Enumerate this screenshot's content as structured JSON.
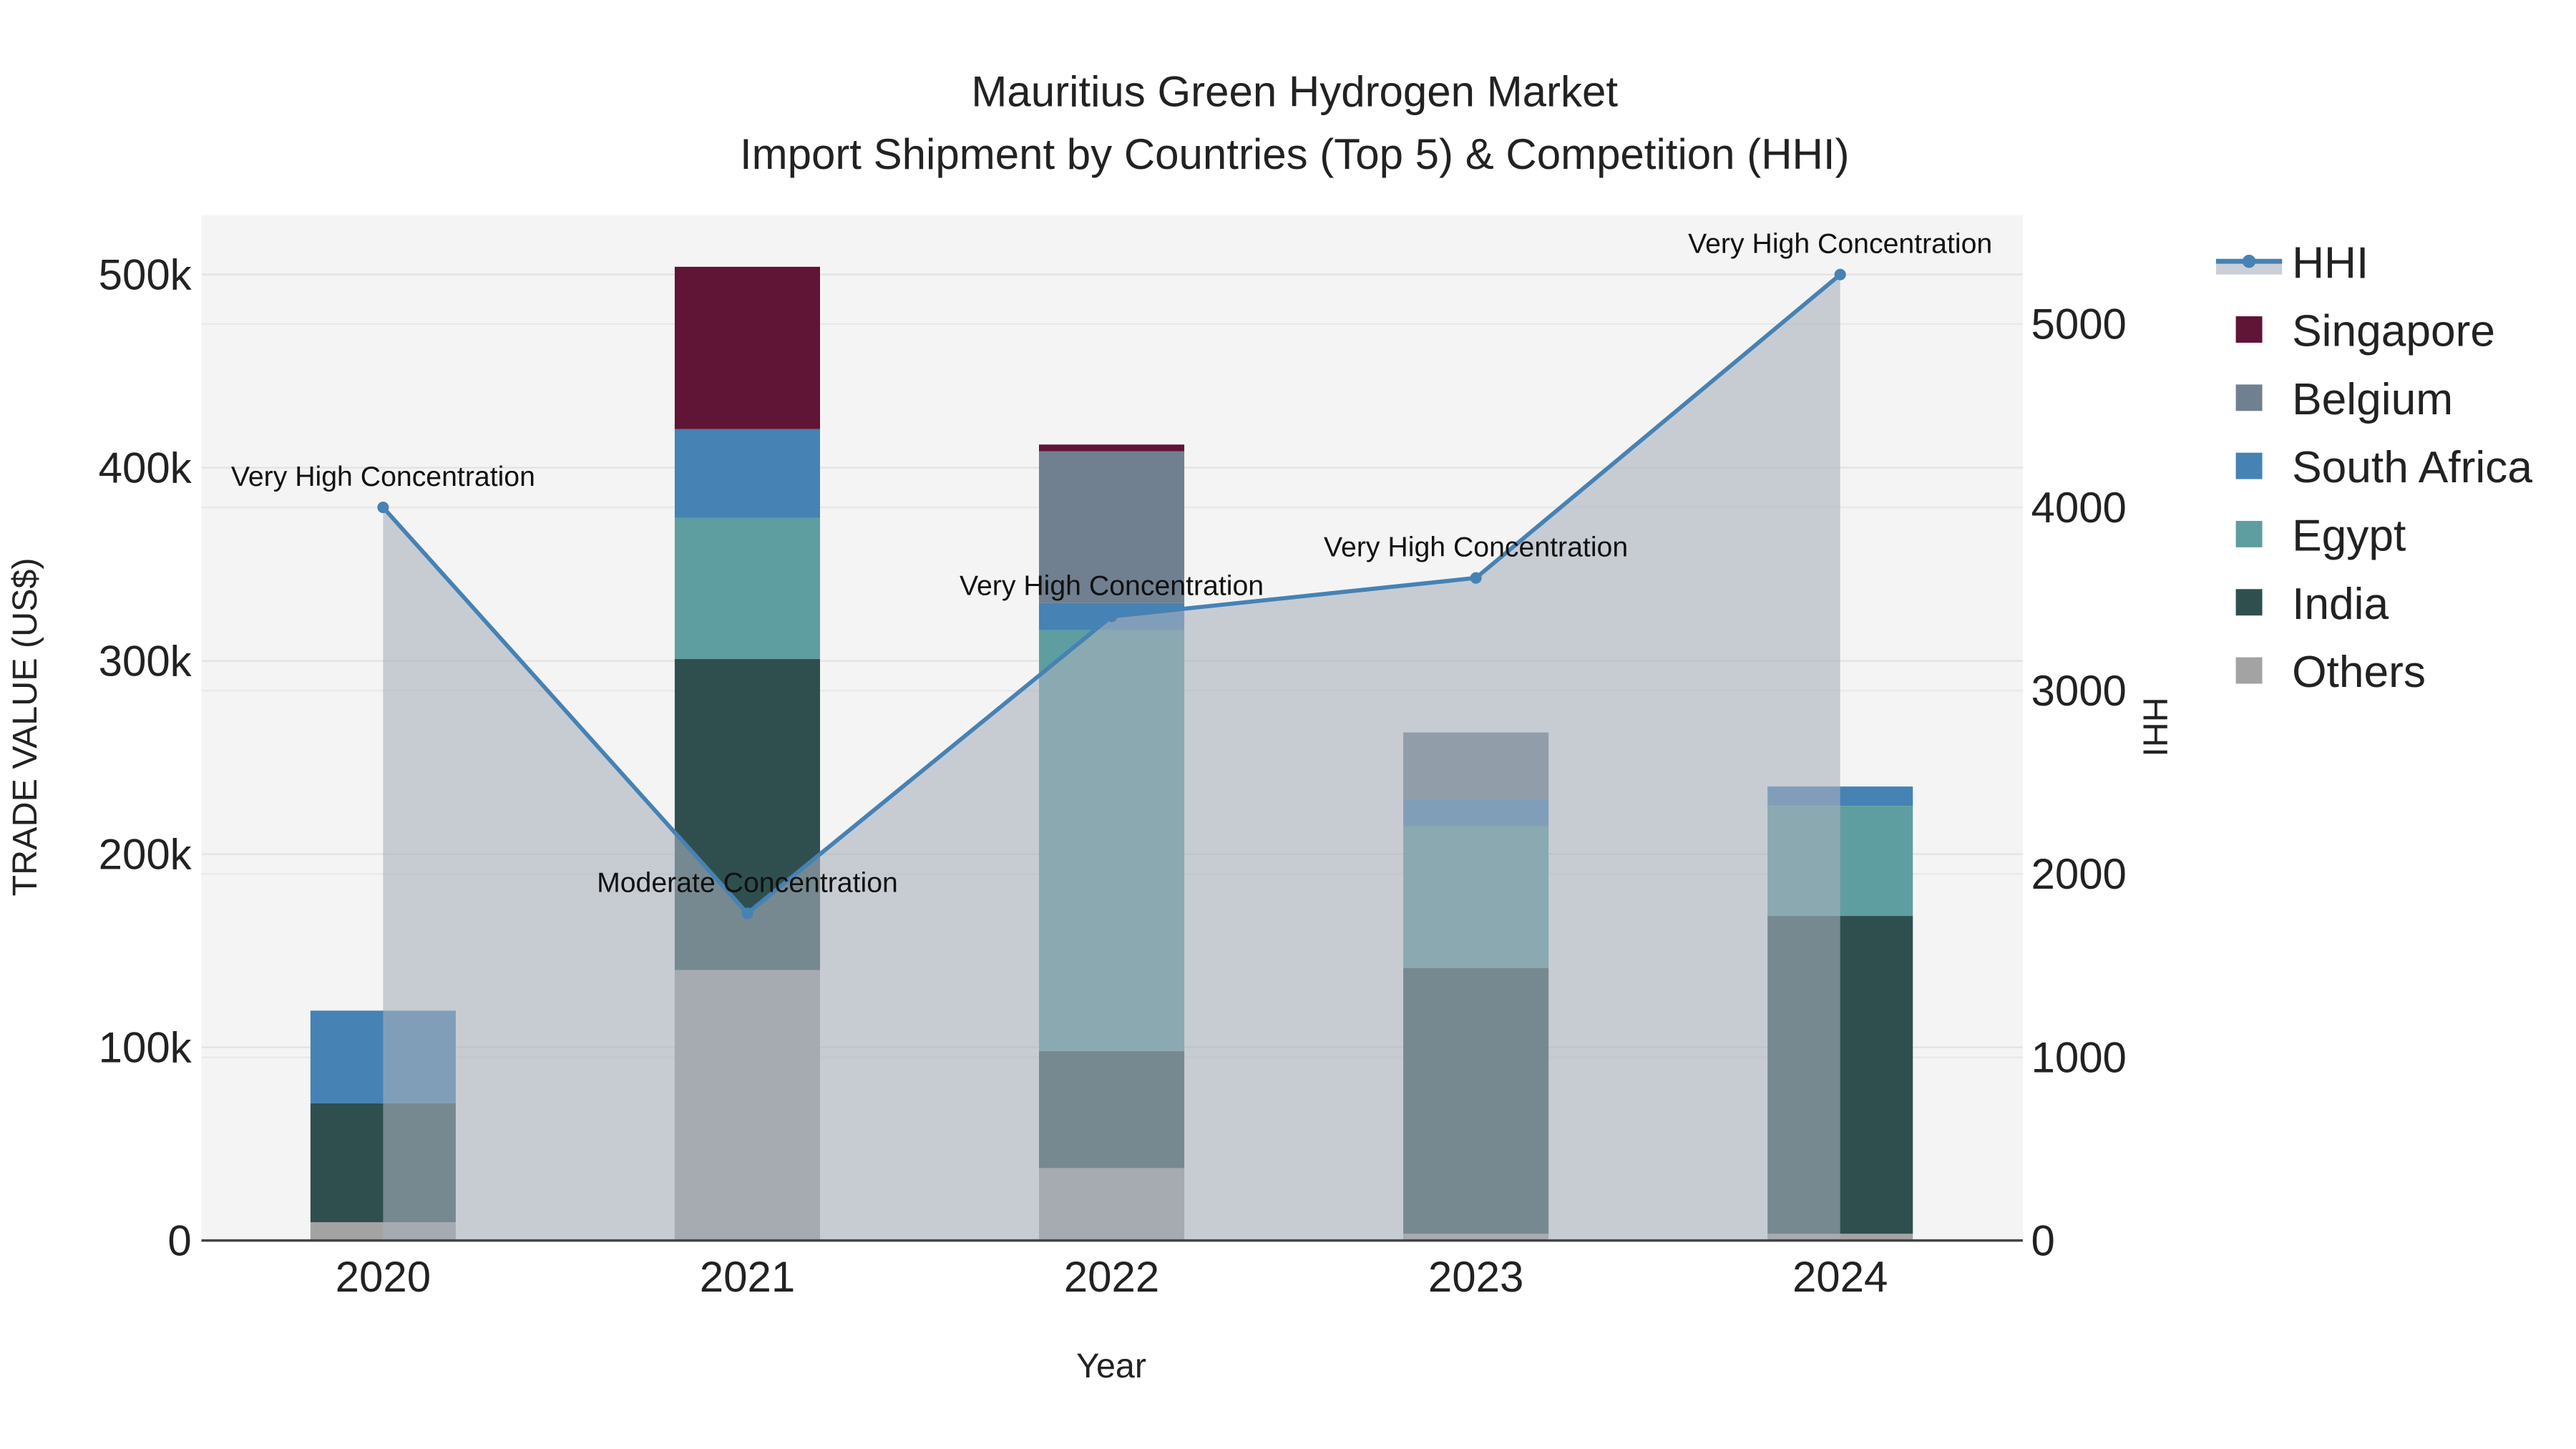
{
  "chart_data": {
    "type": "bar",
    "title": "Mauritius Green Hydrogen Market",
    "subtitle": "Import Shipment by Countries (Top 5) & Competition (HHI)",
    "xlabel": "Year",
    "ylabel": "TRADE VALUE (US$)",
    "y2label": "HHI",
    "categories": [
      "2020",
      "2021",
      "2022",
      "2023",
      "2024"
    ],
    "ylim": [
      0,
      530000
    ],
    "y2lim": [
      0,
      5600
    ],
    "yticks": [
      0,
      100000,
      200000,
      300000,
      400000,
      500000
    ],
    "ytick_labels": [
      "0",
      "100k",
      "200k",
      "300k",
      "400k",
      "500k"
    ],
    "y2ticks": [
      0,
      1000,
      2000,
      3000,
      4000,
      5000
    ],
    "y2tick_labels": [
      "0",
      "1000",
      "2000",
      "3000",
      "4000",
      "5000"
    ],
    "stacked": true,
    "legend_position": "right",
    "series": [
      {
        "name": "Others",
        "color": "#a3a3a3",
        "values": [
          9500,
          140000,
          37500,
          3500,
          3500
        ]
      },
      {
        "name": "India",
        "color": "#2f4f4f",
        "values": [
          61500,
          161000,
          60500,
          137500,
          164500
        ]
      },
      {
        "name": "Egypt",
        "color": "#5f9ea0",
        "values": [
          0,
          73000,
          218000,
          73500,
          57000
        ]
      },
      {
        "name": "South Africa",
        "color": "#4682b4",
        "values": [
          48000,
          46000,
          14000,
          13500,
          10000
        ]
      },
      {
        "name": "Belgium",
        "color": "#708090",
        "values": [
          0,
          0,
          78500,
          35000,
          0
        ]
      },
      {
        "name": "Singapore",
        "color": "#601436",
        "values": [
          0,
          84000,
          3500,
          0,
          0
        ]
      }
    ],
    "hhi": {
      "name": "HHI",
      "color": "#4682b4",
      "area_color": "#a9b0bc",
      "values": [
        4000,
        1785,
        3405,
        3615,
        5270
      ],
      "annotations": [
        "Very High Concentration",
        "Moderate Concentration",
        "Very High Concentration",
        "Very High Concentration",
        "Very High Concentration"
      ]
    },
    "legend_order": [
      "HHI",
      "Singapore",
      "Belgium",
      "South Africa",
      "Egypt",
      "India",
      "Others"
    ]
  }
}
